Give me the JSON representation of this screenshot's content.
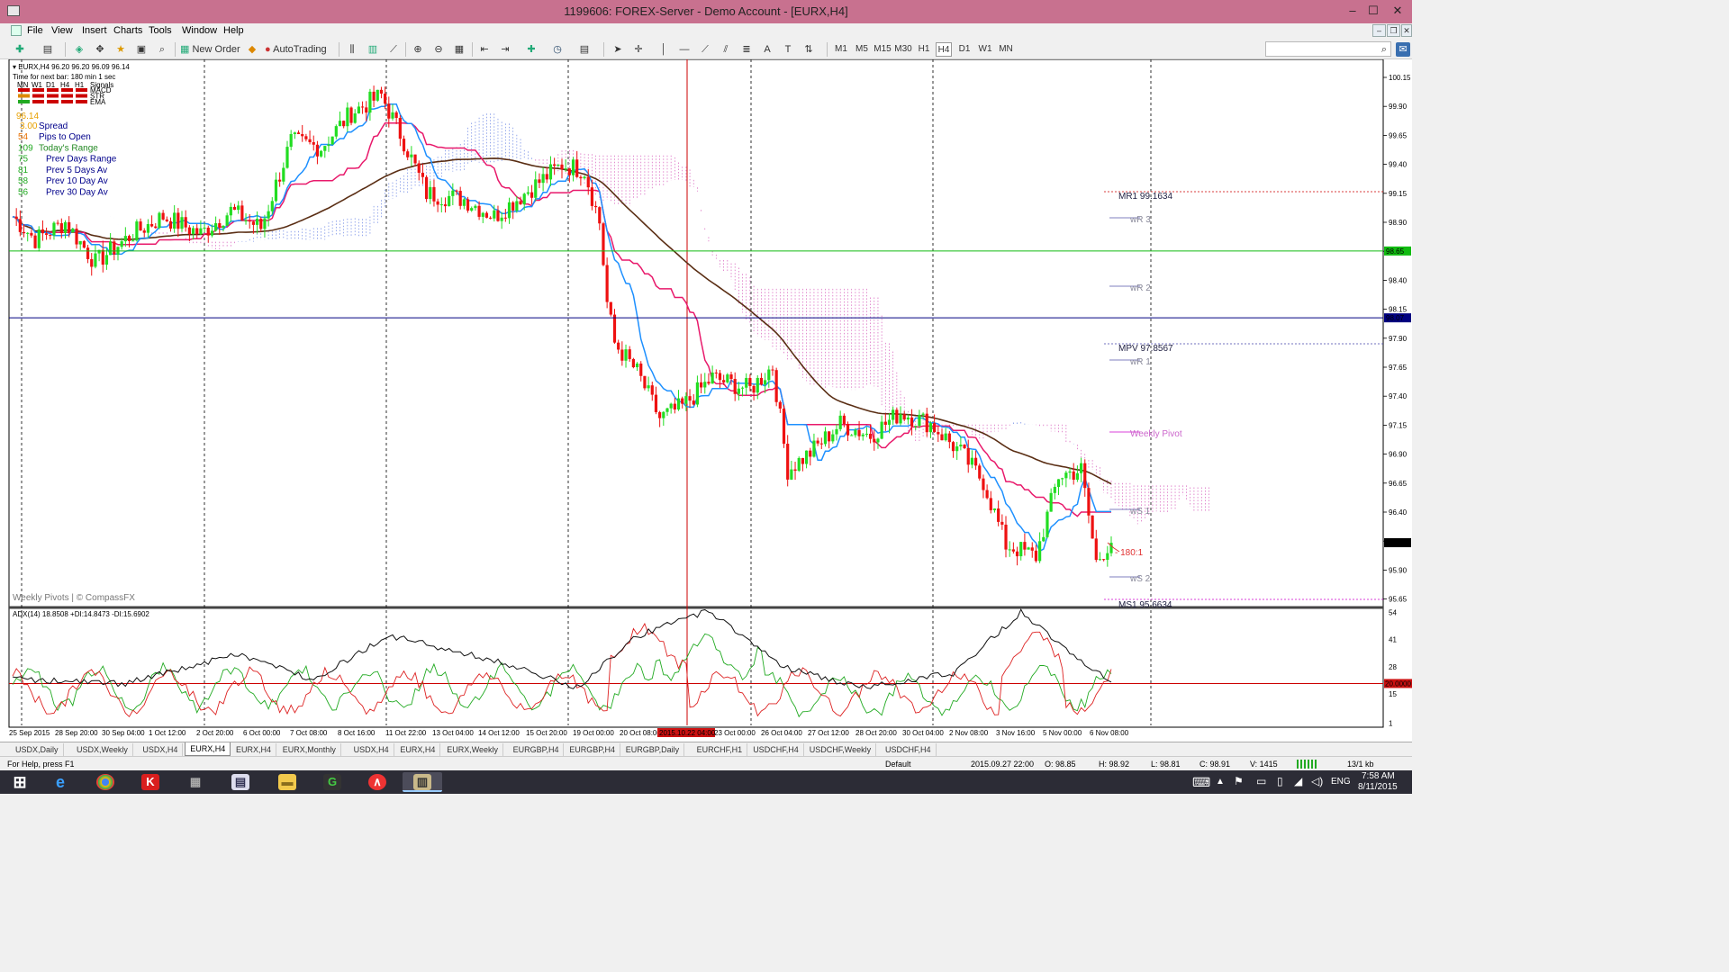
{
  "window": {
    "title": "1199606: FOREX-Server - Demo Account - [EURX,H4]",
    "minimize": "–",
    "maximize": "☐",
    "close": "✕"
  },
  "menu": [
    "File",
    "View",
    "Insert",
    "Charts",
    "Tools",
    "Window",
    "Help"
  ],
  "toolbar": {
    "new_order": "New Order",
    "autotrading": "AutoTrading",
    "timeframes": [
      "M1",
      "M5",
      "M15",
      "M30",
      "H1",
      "H4",
      "D1",
      "W1",
      "MN"
    ],
    "active_timeframe": "H4"
  },
  "chart": {
    "symbol_line": "EURX,H4  96.20 96.20 96.09 96.14",
    "next_bar": "Time for next bar: 180 min 1 sec",
    "signal_header": [
      "MN",
      "W1",
      "D1",
      "H4",
      "H1",
      "Signals"
    ],
    "signal_rows": [
      "MACD",
      "STR",
      "EMA"
    ],
    "price_big": "96.14",
    "spread_value": "3.00",
    "spread_label": "Spread",
    "stats": [
      {
        "value": "54",
        "label": "Pips to Open"
      },
      {
        "value": "109",
        "label": "Today's Range"
      },
      {
        "value": "75",
        "label": "Prev Days Range"
      },
      {
        "value": "81",
        "label": "Prev 5 Days Av"
      },
      {
        "value": "58",
        "label": "Prev 10 Day Av"
      },
      {
        "value": "56",
        "label": "Prev 30 Day Av"
      }
    ],
    "pivot_labels": [
      {
        "name": "MR1",
        "value": "99.1634"
      },
      {
        "name": "wR 3",
        "value": ""
      },
      {
        "name": "wR 2",
        "value": ""
      },
      {
        "name": "MPV",
        "value": "97.8567"
      },
      {
        "name": "wR 1",
        "value": ""
      },
      {
        "name": "Weekly Pivot",
        "value": ""
      },
      {
        "name": "wS 1",
        "value": ""
      },
      {
        "name": "wS 2",
        "value": ""
      },
      {
        "name": "MS1",
        "value": "95.6634"
      }
    ],
    "ratio_label": "180:1",
    "credit": "Weekly Pivots | © CompassFX",
    "price_axis": [
      "100.15",
      "99.90",
      "99.65",
      "99.40",
      "99.15",
      "98.90",
      "98.65",
      "98.40",
      "98.15",
      "97.90",
      "97.65",
      "97.40",
      "97.15",
      "96.90",
      "96.65",
      "96.40",
      "96.15",
      "95.90",
      "95.65"
    ],
    "price_markers": {
      "green": "98.65",
      "navy": "98.07",
      "current": "96.14"
    },
    "time_axis": [
      "25 Sep 2015",
      "28 Sep 20:00",
      "30 Sep 04:00",
      "1 Oct 12:00",
      "2 Oct 20:00",
      "6 Oct 00:00",
      "7 Oct 08:00",
      "8 Oct 16:00",
      "11 Oct 22:00",
      "13 Oct 04:00",
      "14 Oct 12:00",
      "15 Oct 20:00",
      "19 Oct 00:00",
      "20 Oct 08:00",
      "23 Oct 00:00",
      "26 Oct 04:00",
      "27 Oct 12:00",
      "28 Oct 20:00",
      "30 Oct 04:00",
      "2 Nov 08:00",
      "3 Nov 16:00",
      "5 Nov 00:00",
      "6 Nov 08:00"
    ],
    "time_cursor": "2015.10.22 04:00",
    "adx_label": "ADX(14) 18.8508 +DI:14.8473 -DI:15.6902",
    "adx_axis": [
      "54",
      "41",
      "28",
      "15",
      "1"
    ],
    "adx_marker": "20.0000",
    "colors": {
      "bull": "#22dd22",
      "bear": "#ee1111",
      "kijun": "#e8196b",
      "tenkan": "#1e90ff",
      "ma": "#5a2e14",
      "cloud": "#cc33aa",
      "cloud_blue": "#4466dd"
    }
  },
  "tabs": [
    "USDX,Daily",
    "USDX,Weekly",
    "USDX,H4",
    "EURX,H4",
    "EURX,H4",
    "EURX,Monthly",
    "USDX,H4",
    "EURX,H4",
    "EURX,Weekly",
    "EURGBP,H4",
    "EURGBP,H4",
    "EURGBP,Daily",
    "EURCHF,H1",
    "USDCHF,H4",
    "USDCHF,Weekly",
    "USDCHF,H4"
  ],
  "active_tab": 3,
  "status": {
    "help": "For Help, press F1",
    "profile": "Default",
    "datetime": "2015.09.27 22:00",
    "open": "O: 98.85",
    "high": "H: 98.92",
    "low": "L: 98.81",
    "close": "C: 98.91",
    "volume": "V: 1415",
    "traffic": "13/1 kb"
  },
  "tray": {
    "lang": "ENG",
    "time": "7:58 AM",
    "date": "8/11/2015"
  }
}
